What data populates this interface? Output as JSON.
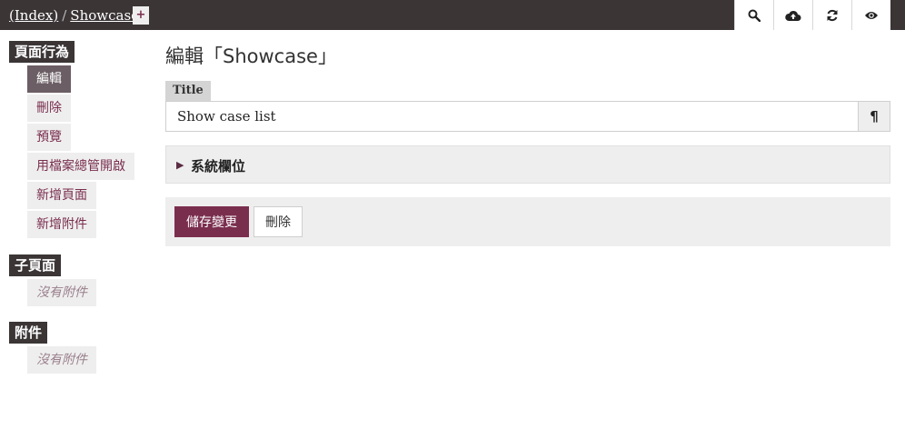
{
  "breadcrumb": {
    "index": "(Index)",
    "separator": "/",
    "current": "Showcase"
  },
  "topbar": {
    "add": "+",
    "tools": [
      {
        "icon": "search-icon"
      },
      {
        "icon": "cloud-upload-icon"
      },
      {
        "icon": "refresh-icon"
      },
      {
        "icon": "eye-icon"
      }
    ]
  },
  "sidebar": {
    "actions_header": "頁面行為",
    "actions": [
      "編輯",
      "刪除",
      "預覽",
      "用檔案總管開啟",
      "新增頁面",
      "新增附件"
    ],
    "subpages_header": "子頁面",
    "subpages_empty": "沒有附件",
    "attachments_header": "附件",
    "attachments_empty": "沒有附件"
  },
  "main": {
    "title": "編輯「Showcase」",
    "field_label": "Title",
    "field_value": "Show case list",
    "pilcrow": "¶",
    "system_fields": "系統欄位",
    "save_label": "儲存變更",
    "delete_label": "刪除"
  },
  "colors": {
    "topbar": "#3b3536",
    "accent": "#7a2e4e",
    "active": "#6b5e64"
  }
}
